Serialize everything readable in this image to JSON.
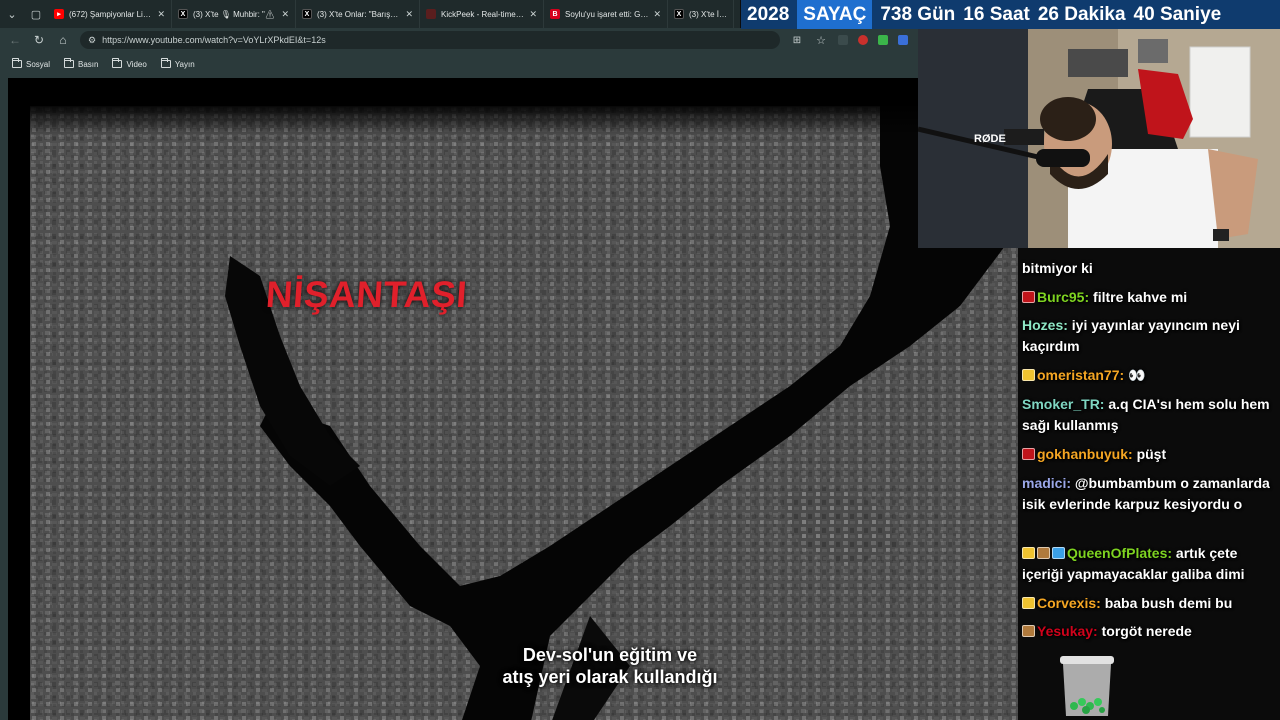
{
  "browser": {
    "tabs": [
      {
        "favicon": "youtube-icon",
        "title": "(672) Şampiyonlar Ligi Y..."
      },
      {
        "favicon": "x-icon",
        "title": "(3) X'te 🎙 Muhbir: \"⚠"
      },
      {
        "favicon": "x-icon",
        "title": "(3) X'te Onlar: \"Barış Peh..."
      },
      {
        "favicon": "kickpeek-icon",
        "title": "KickPeek - Real-time UR..."
      },
      {
        "favicon": "b-icon",
        "title": "Soylu'yu işaret etti: Gül..."
      },
      {
        "favicon": "x-icon",
        "title": "(3) X'te İzafi"
      }
    ],
    "url": "https://www.youtube.com/watch?v=VoYLrXPkdEI&t=12s",
    "bookmarks": [
      "Sosyal",
      "Basın",
      "Video",
      "Yayın"
    ]
  },
  "video": {
    "district_label": "NİŞANTAŞI",
    "subtitle_line1": "Dev-sol'un eğitim ve",
    "subtitle_line2": "atış yeri olarak kullandığı"
  },
  "counter": {
    "year": "2028",
    "label": "SAYAÇ",
    "days": "738 Gün",
    "hours": "16 Saat",
    "minutes": "26 Dakika",
    "seconds": "40 Saniye"
  },
  "webcam": {
    "mic_brand": "RØDE"
  },
  "chat": {
    "messages": [
      {
        "user": "",
        "user_color": "#ffffff",
        "badges": [],
        "text": "bitmiyor ki"
      },
      {
        "user": "Burc95:",
        "user_color": "#7ed321",
        "badges": [
          "#c0141b"
        ],
        "text": "filtre kahve mi"
      },
      {
        "user": "Hozes:",
        "user_color": "#8ee6c4",
        "badges": [],
        "text": "iyi yayınlar yayıncım neyi kaçırdım"
      },
      {
        "user": "omeristan77:",
        "user_color": "#f5a623",
        "badges": [
          "#f0c330"
        ],
        "text": "👀"
      },
      {
        "user": "Smoker_TR:",
        "user_color": "#7fd6c2",
        "badges": [],
        "text": "a.q CIA'sı hem solu hem sağı kullanmış"
      },
      {
        "user": "gokhanbuyuk:",
        "user_color": "#f5a623",
        "badges": [
          "#c0141b"
        ],
        "text": "püşt"
      },
      {
        "user": "madici:",
        "user_color": "#9aa7e8",
        "badges": [],
        "text": "@bumbambum o zamanlarda isik evlerinde karpuz kesiyordu o"
      },
      {
        "user": "QueenOfPlates:",
        "user_color": "#7ed321",
        "badges": [
          "#f0c330",
          "#b07a3c",
          "#3aa0e8"
        ],
        "text": "artık çete içeriği yapmayacaklar galiba dimi"
      },
      {
        "user": "Corvexis:",
        "user_color": "#f5a623",
        "badges": [
          "#f0c330"
        ],
        "text": "baba bush demi bu"
      },
      {
        "user": "Yesukay:",
        "user_color": "#d0021b",
        "badges": [
          "#b07a3c"
        ],
        "text": "torgöt nerede"
      }
    ]
  }
}
